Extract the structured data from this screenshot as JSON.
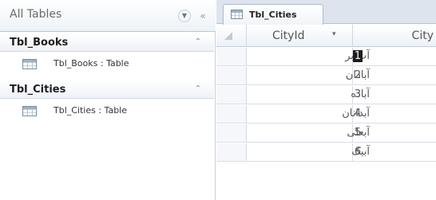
{
  "nav": {
    "title": "All Tables",
    "groups": [
      {
        "label": "Tbl_Books",
        "item": "Tbl_Books : Table"
      },
      {
        "label": "Tbl_Cities",
        "item": "Tbl_Cities : Table"
      }
    ]
  },
  "sheet": {
    "tab_label": "Tbl_Cities",
    "columns": [
      "CityId",
      "City"
    ],
    "rows": [
      {
        "name": "آب بر",
        "num": "1"
      },
      {
        "name": "آبادان",
        "num": "2"
      },
      {
        "name": "آباده",
        "num": "3"
      },
      {
        "name": "آبدانان",
        "num": "4"
      },
      {
        "name": "آبعلی",
        "num": "5"
      },
      {
        "name": "آبیک",
        "num": "6"
      }
    ]
  }
}
